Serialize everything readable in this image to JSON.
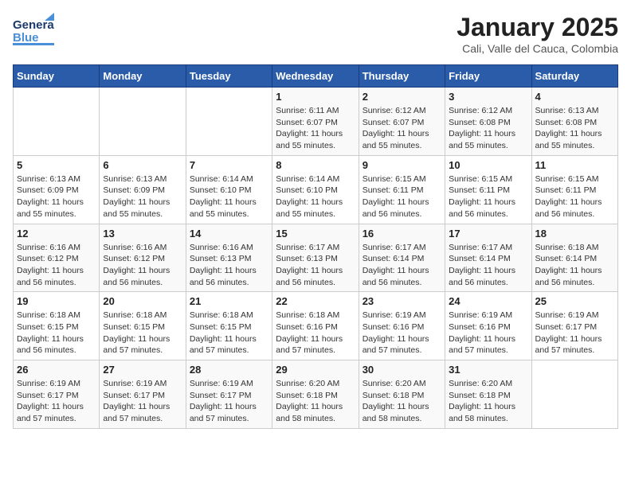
{
  "header": {
    "logo_general": "General",
    "logo_blue": "Blue",
    "month_year": "January 2025",
    "location": "Cali, Valle del Cauca, Colombia"
  },
  "weekdays": [
    "Sunday",
    "Monday",
    "Tuesday",
    "Wednesday",
    "Thursday",
    "Friday",
    "Saturday"
  ],
  "weeks": [
    [
      {
        "day": "",
        "sunrise": "",
        "sunset": "",
        "daylight": ""
      },
      {
        "day": "",
        "sunrise": "",
        "sunset": "",
        "daylight": ""
      },
      {
        "day": "",
        "sunrise": "",
        "sunset": "",
        "daylight": ""
      },
      {
        "day": "1",
        "sunrise": "Sunrise: 6:11 AM",
        "sunset": "Sunset: 6:07 PM",
        "daylight": "Daylight: 11 hours and 55 minutes."
      },
      {
        "day": "2",
        "sunrise": "Sunrise: 6:12 AM",
        "sunset": "Sunset: 6:07 PM",
        "daylight": "Daylight: 11 hours and 55 minutes."
      },
      {
        "day": "3",
        "sunrise": "Sunrise: 6:12 AM",
        "sunset": "Sunset: 6:08 PM",
        "daylight": "Daylight: 11 hours and 55 minutes."
      },
      {
        "day": "4",
        "sunrise": "Sunrise: 6:13 AM",
        "sunset": "Sunset: 6:08 PM",
        "daylight": "Daylight: 11 hours and 55 minutes."
      }
    ],
    [
      {
        "day": "5",
        "sunrise": "Sunrise: 6:13 AM",
        "sunset": "Sunset: 6:09 PM",
        "daylight": "Daylight: 11 hours and 55 minutes."
      },
      {
        "day": "6",
        "sunrise": "Sunrise: 6:13 AM",
        "sunset": "Sunset: 6:09 PM",
        "daylight": "Daylight: 11 hours and 55 minutes."
      },
      {
        "day": "7",
        "sunrise": "Sunrise: 6:14 AM",
        "sunset": "Sunset: 6:10 PM",
        "daylight": "Daylight: 11 hours and 55 minutes."
      },
      {
        "day": "8",
        "sunrise": "Sunrise: 6:14 AM",
        "sunset": "Sunset: 6:10 PM",
        "daylight": "Daylight: 11 hours and 55 minutes."
      },
      {
        "day": "9",
        "sunrise": "Sunrise: 6:15 AM",
        "sunset": "Sunset: 6:11 PM",
        "daylight": "Daylight: 11 hours and 56 minutes."
      },
      {
        "day": "10",
        "sunrise": "Sunrise: 6:15 AM",
        "sunset": "Sunset: 6:11 PM",
        "daylight": "Daylight: 11 hours and 56 minutes."
      },
      {
        "day": "11",
        "sunrise": "Sunrise: 6:15 AM",
        "sunset": "Sunset: 6:11 PM",
        "daylight": "Daylight: 11 hours and 56 minutes."
      }
    ],
    [
      {
        "day": "12",
        "sunrise": "Sunrise: 6:16 AM",
        "sunset": "Sunset: 6:12 PM",
        "daylight": "Daylight: 11 hours and 56 minutes."
      },
      {
        "day": "13",
        "sunrise": "Sunrise: 6:16 AM",
        "sunset": "Sunset: 6:12 PM",
        "daylight": "Daylight: 11 hours and 56 minutes."
      },
      {
        "day": "14",
        "sunrise": "Sunrise: 6:16 AM",
        "sunset": "Sunset: 6:13 PM",
        "daylight": "Daylight: 11 hours and 56 minutes."
      },
      {
        "day": "15",
        "sunrise": "Sunrise: 6:17 AM",
        "sunset": "Sunset: 6:13 PM",
        "daylight": "Daylight: 11 hours and 56 minutes."
      },
      {
        "day": "16",
        "sunrise": "Sunrise: 6:17 AM",
        "sunset": "Sunset: 6:14 PM",
        "daylight": "Daylight: 11 hours and 56 minutes."
      },
      {
        "day": "17",
        "sunrise": "Sunrise: 6:17 AM",
        "sunset": "Sunset: 6:14 PM",
        "daylight": "Daylight: 11 hours and 56 minutes."
      },
      {
        "day": "18",
        "sunrise": "Sunrise: 6:18 AM",
        "sunset": "Sunset: 6:14 PM",
        "daylight": "Daylight: 11 hours and 56 minutes."
      }
    ],
    [
      {
        "day": "19",
        "sunrise": "Sunrise: 6:18 AM",
        "sunset": "Sunset: 6:15 PM",
        "daylight": "Daylight: 11 hours and 56 minutes."
      },
      {
        "day": "20",
        "sunrise": "Sunrise: 6:18 AM",
        "sunset": "Sunset: 6:15 PM",
        "daylight": "Daylight: 11 hours and 57 minutes."
      },
      {
        "day": "21",
        "sunrise": "Sunrise: 6:18 AM",
        "sunset": "Sunset: 6:15 PM",
        "daylight": "Daylight: 11 hours and 57 minutes."
      },
      {
        "day": "22",
        "sunrise": "Sunrise: 6:18 AM",
        "sunset": "Sunset: 6:16 PM",
        "daylight": "Daylight: 11 hours and 57 minutes."
      },
      {
        "day": "23",
        "sunrise": "Sunrise: 6:19 AM",
        "sunset": "Sunset: 6:16 PM",
        "daylight": "Daylight: 11 hours and 57 minutes."
      },
      {
        "day": "24",
        "sunrise": "Sunrise: 6:19 AM",
        "sunset": "Sunset: 6:16 PM",
        "daylight": "Daylight: 11 hours and 57 minutes."
      },
      {
        "day": "25",
        "sunrise": "Sunrise: 6:19 AM",
        "sunset": "Sunset: 6:17 PM",
        "daylight": "Daylight: 11 hours and 57 minutes."
      }
    ],
    [
      {
        "day": "26",
        "sunrise": "Sunrise: 6:19 AM",
        "sunset": "Sunset: 6:17 PM",
        "daylight": "Daylight: 11 hours and 57 minutes."
      },
      {
        "day": "27",
        "sunrise": "Sunrise: 6:19 AM",
        "sunset": "Sunset: 6:17 PM",
        "daylight": "Daylight: 11 hours and 57 minutes."
      },
      {
        "day": "28",
        "sunrise": "Sunrise: 6:19 AM",
        "sunset": "Sunset: 6:17 PM",
        "daylight": "Daylight: 11 hours and 57 minutes."
      },
      {
        "day": "29",
        "sunrise": "Sunrise: 6:20 AM",
        "sunset": "Sunset: 6:18 PM",
        "daylight": "Daylight: 11 hours and 58 minutes."
      },
      {
        "day": "30",
        "sunrise": "Sunrise: 6:20 AM",
        "sunset": "Sunset: 6:18 PM",
        "daylight": "Daylight: 11 hours and 58 minutes."
      },
      {
        "day": "31",
        "sunrise": "Sunrise: 6:20 AM",
        "sunset": "Sunset: 6:18 PM",
        "daylight": "Daylight: 11 hours and 58 minutes."
      },
      {
        "day": "",
        "sunrise": "",
        "sunset": "",
        "daylight": ""
      }
    ]
  ]
}
